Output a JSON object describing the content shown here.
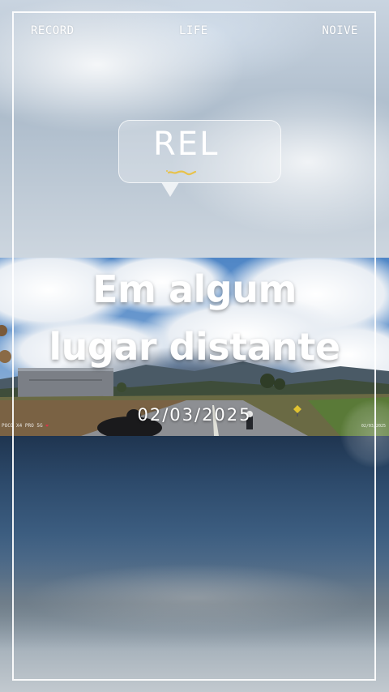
{
  "header": {
    "left_label": "RECORD",
    "center_label": "LIFE",
    "right_label": "NOIVE"
  },
  "bubble": {
    "text": "REL",
    "accent_color": "#e8c24a"
  },
  "headline": {
    "line1": "Em algum",
    "line2": "lugar distante"
  },
  "date": "02/03/2025",
  "overlay_stamps": {
    "left": "POCO X4 PRO 5G",
    "right": "02/03/2025"
  },
  "icons": [
    "speech-bubble-icon",
    "heart-icon"
  ],
  "colors": {
    "text": "#ffffff",
    "frame": "#ffffff",
    "sky_dark": "#1f3550"
  }
}
